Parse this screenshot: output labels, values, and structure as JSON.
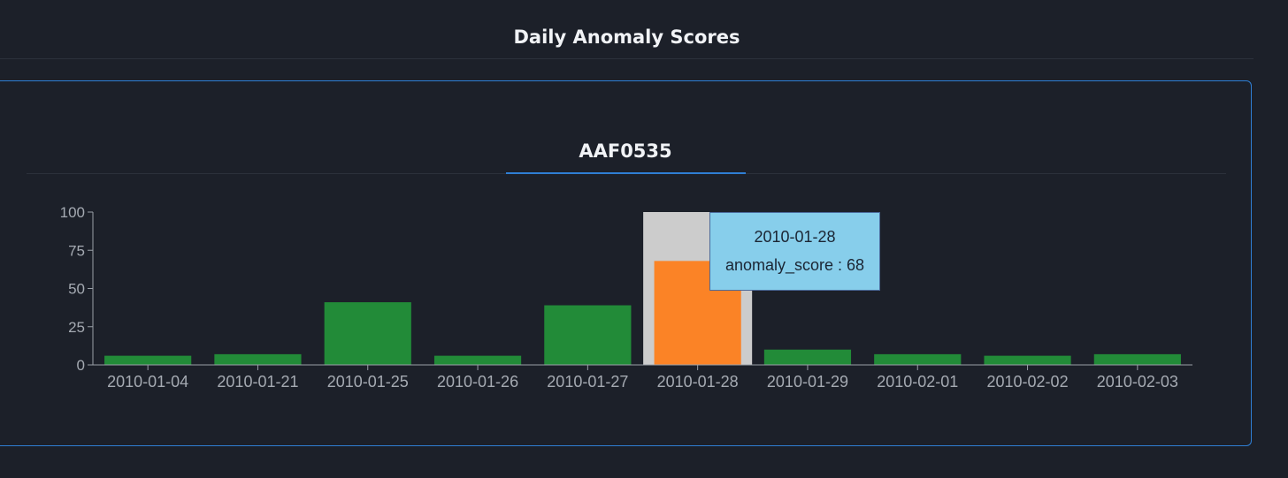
{
  "page": {
    "title": "Daily Anomaly Scores"
  },
  "card": {
    "title": "AAF0535"
  },
  "colors": {
    "bar": "#228b38",
    "highlight_bar": "#fb8326",
    "hover_band": "#cccccc",
    "axis": "#9aa0a8",
    "tick_text": "#a5aab2",
    "tooltip_bg": "#87ceeb"
  },
  "chart_data": {
    "type": "bar",
    "categories": [
      "2010-01-04",
      "2010-01-21",
      "2010-01-25",
      "2010-01-26",
      "2010-01-27",
      "2010-01-28",
      "2010-01-29",
      "2010-02-01",
      "2010-02-02",
      "2010-02-03"
    ],
    "values": [
      6,
      7,
      41,
      6,
      39,
      68,
      10,
      7,
      6,
      7
    ],
    "ylim": [
      0,
      100
    ],
    "yticks": [
      0,
      25,
      50,
      75,
      100
    ],
    "highlighted_category": "2010-01-28",
    "grid": false
  },
  "tooltip": {
    "date": "2010-01-28",
    "label": "anomaly_score : 68"
  }
}
